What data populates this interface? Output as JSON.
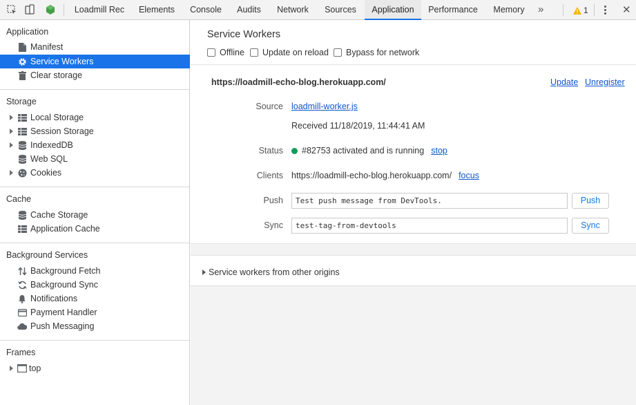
{
  "toolbar": {
    "tabs": [
      {
        "label": "Loadmill Rec"
      },
      {
        "label": "Elements"
      },
      {
        "label": "Console"
      },
      {
        "label": "Audits"
      },
      {
        "label": "Network"
      },
      {
        "label": "Sources"
      },
      {
        "label": "Application",
        "active": true
      },
      {
        "label": "Performance"
      },
      {
        "label": "Memory"
      }
    ],
    "more_label": "»",
    "warning_count": "1",
    "icons": [
      "inspect-icon",
      "device-toggle-icon",
      "node-icon",
      "overflow-tabs-icon",
      "warning-icon",
      "kebab-menu-icon"
    ],
    "accent": "#1a73e8"
  },
  "sidebar": {
    "sections": [
      {
        "title": "Application",
        "items": [
          {
            "label": "Manifest",
            "icon": "document-icon"
          },
          {
            "label": "Service Workers",
            "icon": "gear-icon",
            "selected": true
          },
          {
            "label": "Clear storage",
            "icon": "trash-icon"
          }
        ]
      },
      {
        "title": "Storage",
        "items": [
          {
            "label": "Local Storage",
            "icon": "grid-icon",
            "expandable": true
          },
          {
            "label": "Session Storage",
            "icon": "grid-icon",
            "expandable": true
          },
          {
            "label": "IndexedDB",
            "icon": "database-icon",
            "expandable": true
          },
          {
            "label": "Web SQL",
            "icon": "database-icon"
          },
          {
            "label": "Cookies",
            "icon": "cookie-icon",
            "expandable": true
          }
        ]
      },
      {
        "title": "Cache",
        "items": [
          {
            "label": "Cache Storage",
            "icon": "database-icon"
          },
          {
            "label": "Application Cache",
            "icon": "grid-icon"
          }
        ]
      },
      {
        "title": "Background Services",
        "items": [
          {
            "label": "Background Fetch",
            "icon": "updown-arrows-icon"
          },
          {
            "label": "Background Sync",
            "icon": "sync-icon"
          },
          {
            "label": "Notifications",
            "icon": "bell-icon"
          },
          {
            "label": "Payment Handler",
            "icon": "card-icon"
          },
          {
            "label": "Push Messaging",
            "icon": "cloud-icon"
          }
        ]
      },
      {
        "title": "Frames",
        "items": [
          {
            "label": "top",
            "icon": "frame-icon",
            "expandable": true
          }
        ]
      }
    ],
    "selected_color": "#1a73e8"
  },
  "main": {
    "title": "Service Workers",
    "options": [
      {
        "label": "Offline",
        "checked": false
      },
      {
        "label": "Update on reload",
        "checked": false
      },
      {
        "label": "Bypass for network",
        "checked": false
      }
    ],
    "worker": {
      "origin": "https://loadmill-echo-blog.herokuapp.com/",
      "update_label": "Update",
      "unregister_label": "Unregister",
      "source_label": "Source",
      "source_link": "loadmill-worker.js",
      "received": "Received 11/18/2019, 11:44:41 AM",
      "status_label": "Status",
      "status_text": "#82753 activated and is running",
      "status_color": "#0f9d58",
      "stop_label": "stop",
      "clients_label": "Clients",
      "client_url": "https://loadmill-echo-blog.herokuapp.com/",
      "focus_label": "focus",
      "push_label": "Push",
      "push_value": "Test push message from DevTools.",
      "push_button": "Push",
      "sync_label": "Sync",
      "sync_value": "test-tag-from-devtools",
      "sync_button": "Sync"
    },
    "other_origins_label": "Service workers from other origins"
  }
}
